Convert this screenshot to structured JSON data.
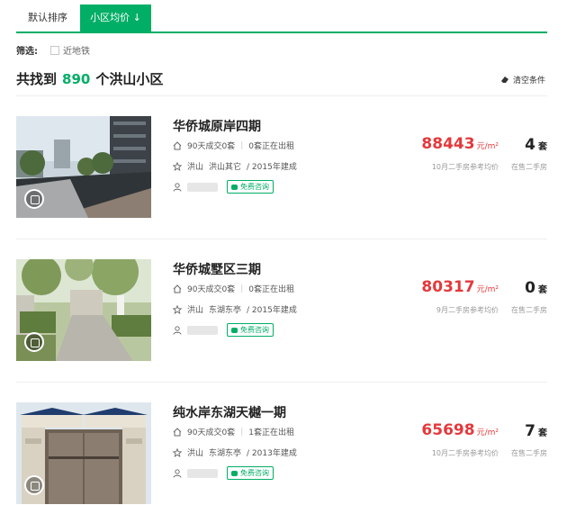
{
  "tabs": [
    {
      "label": "默认排序"
    },
    {
      "label": "小区均价 ↓"
    }
  ],
  "filter": {
    "label": "筛选:",
    "option": "近地铁"
  },
  "headline": {
    "prefix": "共找到",
    "count": "890",
    "suffix": "个洪山小区"
  },
  "clear_label": "清空条件",
  "listings": [
    {
      "name": "华侨城原岸四期",
      "deal": "90天成交0套",
      "rent": "0套正在出租",
      "district": "洪山",
      "area": "洪山其它",
      "built": "/ 2015年建成",
      "consult": "免费咨询",
      "price": "88443",
      "price_unit": "元/m²",
      "price_desc": "10月二手房参考均价",
      "count": "4",
      "count_unit": "套",
      "count_desc": "在售二手房"
    },
    {
      "name": "华侨城墅区三期",
      "deal": "90天成交0套",
      "rent": "0套正在出租",
      "district": "洪山",
      "area": "东湖东亭",
      "built": "/ 2015年建成",
      "consult": "免费咨询",
      "price": "80317",
      "price_unit": "元/m²",
      "price_desc": "9月二手房参考均价",
      "count": "0",
      "count_unit": "套",
      "count_desc": "在售二手房"
    },
    {
      "name": "纯水岸东湖天樾一期",
      "deal": "90天成交0套",
      "rent": "1套正在出租",
      "district": "洪山",
      "area": "东湖东亭",
      "built": "/ 2013年建成",
      "consult": "免费咨询",
      "price": "65698",
      "price_unit": "元/m²",
      "price_desc": "10月二手房参考均价",
      "count": "7",
      "count_unit": "套",
      "count_desc": "在售二手房"
    }
  ],
  "colors": {
    "accent": "#00ae66",
    "price": "#e4393c"
  }
}
